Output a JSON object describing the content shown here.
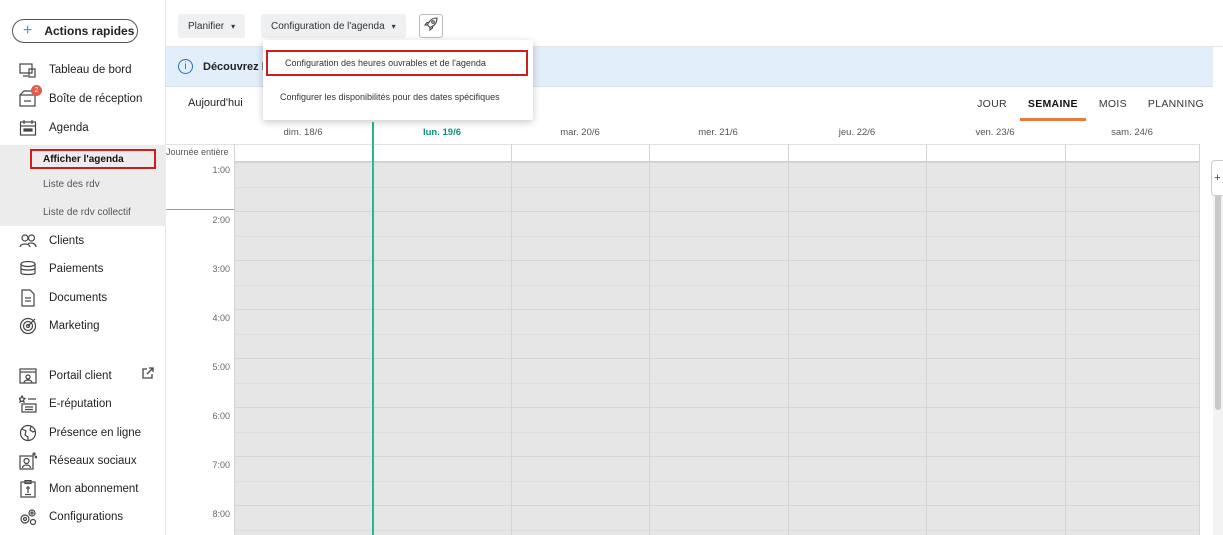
{
  "sidebar": {
    "quick_actions": "Actions rapides",
    "items": [
      {
        "label": "Tableau de bord",
        "icon": "dashboard-icon"
      },
      {
        "label": "Boîte de réception",
        "icon": "inbox-icon",
        "badge": "2"
      },
      {
        "label": "Agenda",
        "icon": "calendar-icon"
      },
      {
        "label": "Clients",
        "icon": "users-icon"
      },
      {
        "label": "Paiements",
        "icon": "payments-icon"
      },
      {
        "label": "Documents",
        "icon": "document-icon"
      },
      {
        "label": "Marketing",
        "icon": "target-icon"
      },
      {
        "label": "Portail client",
        "icon": "portal-icon"
      },
      {
        "label": "E-réputation",
        "icon": "reputation-icon"
      },
      {
        "label": "Présence en ligne",
        "icon": "globe-icon"
      },
      {
        "label": "Réseaux sociaux",
        "icon": "social-icon"
      },
      {
        "label": "Mon abonnement",
        "icon": "subscription-icon"
      },
      {
        "label": "Configurations",
        "icon": "gears-icon"
      }
    ],
    "agenda_sub": [
      "Afficher l'agenda",
      "Liste des rdv",
      "Liste de rdv collectif"
    ]
  },
  "toolbar": {
    "planifier": "Planifier",
    "config": "Configuration de l'agenda",
    "caret": "▾"
  },
  "dropdown": {
    "items": [
      "Configuration des heures ouvrables et de l'agenda",
      "Configurer les disponibilités pour des dates spécifiques"
    ]
  },
  "banner": {
    "text": "Découvrez l"
  },
  "calendar": {
    "today_button": "Aujourd'hui",
    "views": [
      "JOUR",
      "SEMAINE",
      "MOIS",
      "PLANNING"
    ],
    "active_view": "SEMAINE",
    "days": [
      "dim. 18/6",
      "lun. 19/6",
      "mar. 20/6",
      "mer. 21/6",
      "jeu. 22/6",
      "ven. 23/6",
      "sam. 24/6"
    ],
    "today_day": "lun. 19/6",
    "all_day": "Journée entière",
    "hours": [
      "1:00",
      "2:00",
      "3:00",
      "4:00",
      "5:00",
      "6:00",
      "7:00",
      "8:00"
    ]
  },
  "colors": {
    "accent_orange": "#e87a3d",
    "today_green": "#12927e",
    "highlight_red": "#cc1e1e",
    "banner_bg": "#e3eefb"
  }
}
